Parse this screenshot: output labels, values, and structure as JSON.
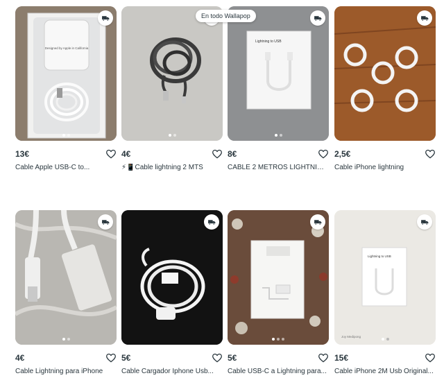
{
  "badge": {
    "label": "En todo Wallapop"
  },
  "listings": [
    {
      "price": "13€",
      "title": "Cable Apple USB-C to...",
      "photo_text": "Designed by Apple in California"
    },
    {
      "price": "4€",
      "title": "⚡📱Cable lightning 2 MTS"
    },
    {
      "price": "8€",
      "title": "CABLE 2 METROS LIGHTNING...",
      "photo_text": "Lightning to USB"
    },
    {
      "price": "2,5€",
      "title": "Cable iPhone lightning"
    },
    {
      "price": "4€",
      "title": "Cable Lightning para iPhone"
    },
    {
      "price": "5€",
      "title": "Cable Cargador Iphone Usb..."
    },
    {
      "price": "5€",
      "title": "Cable USB-C a Lightning para..."
    },
    {
      "price": "15€",
      "title": "Cable iPhone 2M Usb Original...",
      "photo_text": "Lightning to USB",
      "photo_caption": "Joy Medipong"
    }
  ],
  "icons": {
    "shipping": "truck-icon",
    "favorite": "heart-outline-icon"
  }
}
